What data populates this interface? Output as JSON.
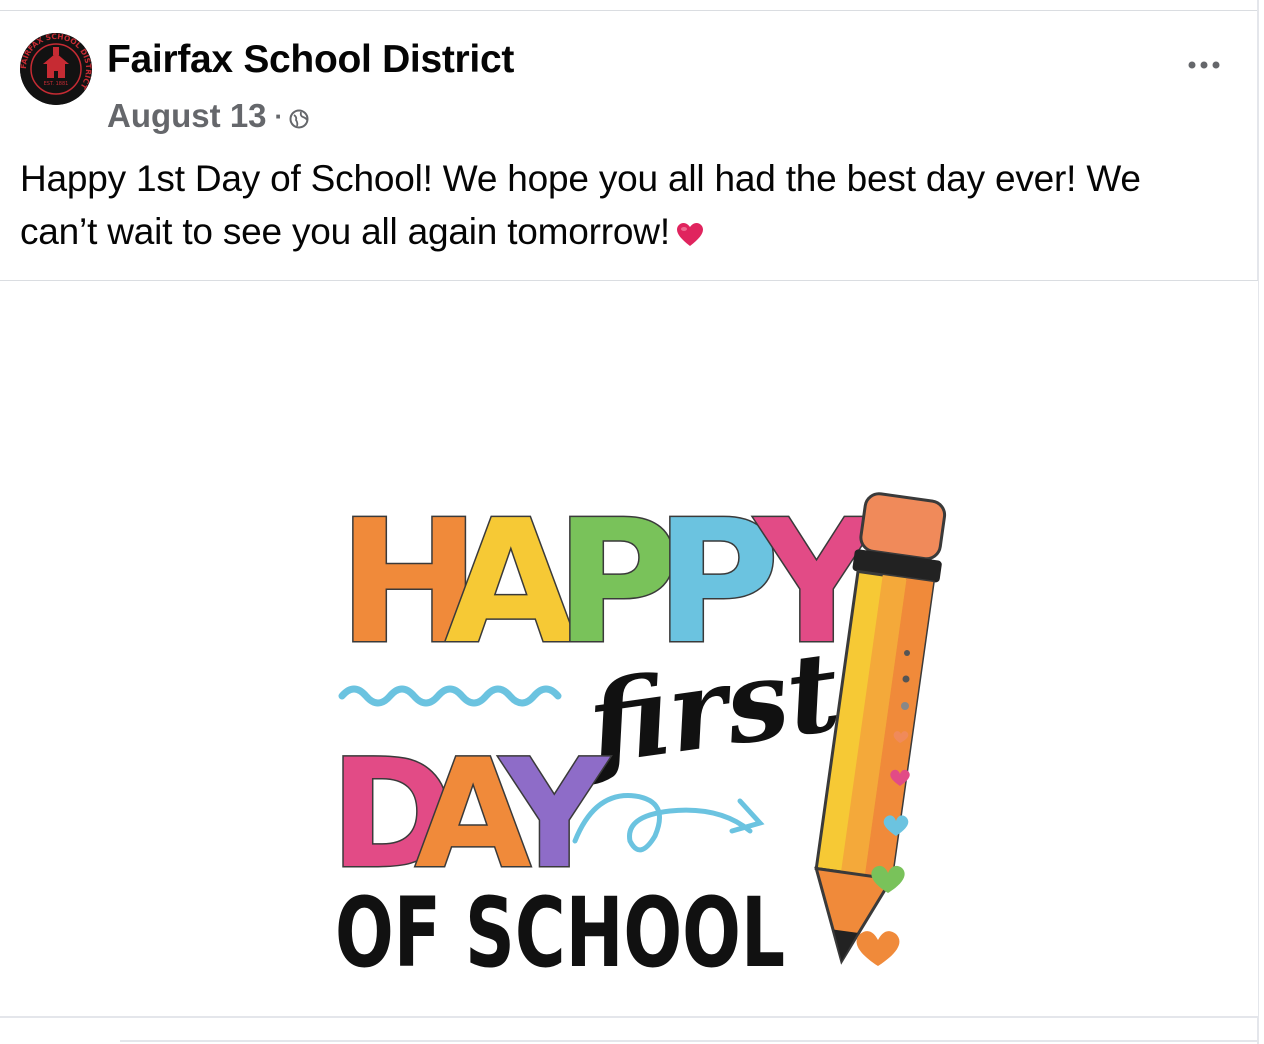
{
  "post": {
    "author": "Fairfax School District",
    "date": "August 13",
    "separator": "·",
    "audience_icon": "globe-icon",
    "more_icon": "more-options-icon",
    "text_line1": "Happy 1st Day of School! We hope you all had the best day ever! We",
    "text_line2": "can’t wait to see you all again tomorrow!",
    "emoji": "red-heart-icon",
    "avatar": {
      "ring_text": "FAIRFAX SCHOOL DISTRICT",
      "est": "EST. 1881"
    },
    "image": {
      "line1": "HAPPY",
      "line2": "first",
      "line3": "DAY",
      "line4": "OF SCHOOL"
    }
  },
  "colors": {
    "text": "#050505",
    "secondary_text": "#65676b",
    "divider": "#dadde1",
    "heart": "#e0245e",
    "letter_orange": "#f08a3a",
    "letter_yellow": "#f6c935",
    "letter_green": "#79c25a",
    "letter_blue": "#6bc3e0",
    "letter_pink": "#e24b86",
    "letter_purple": "#8e6cc8"
  }
}
